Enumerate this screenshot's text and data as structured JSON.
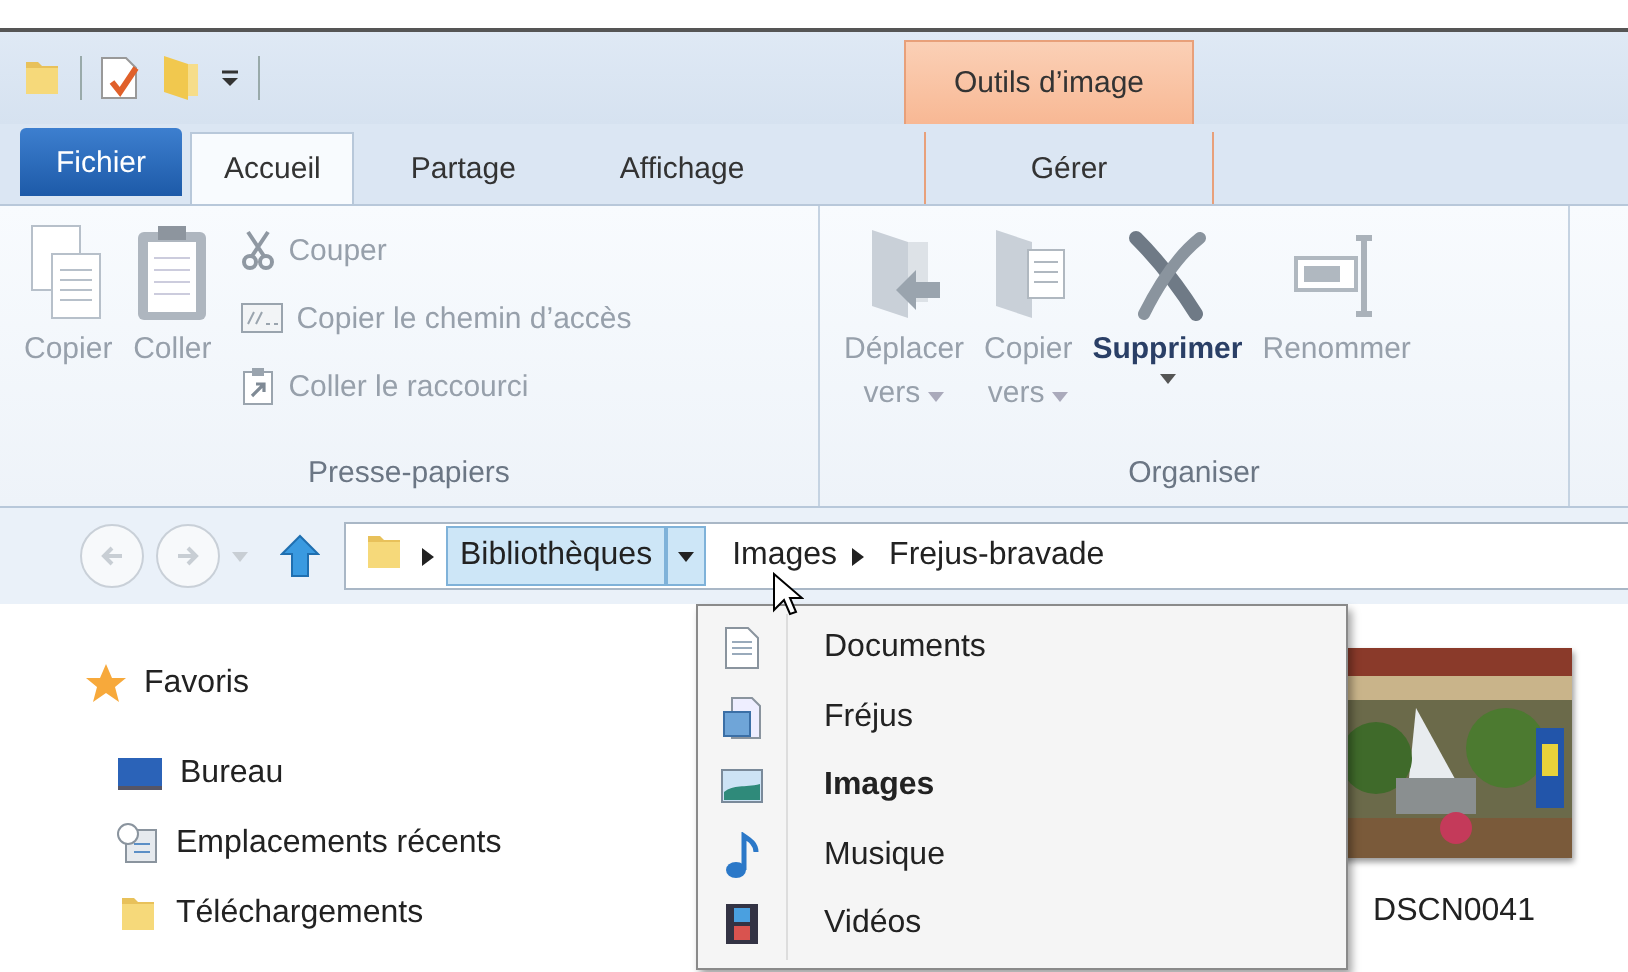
{
  "context_tab": {
    "title": "Outils d’image"
  },
  "tabs": [
    {
      "label": "Fichier",
      "kind": "file",
      "selected": false
    },
    {
      "label": "Accueil",
      "kind": "tab",
      "selected": true
    },
    {
      "label": "Partage",
      "kind": "tab",
      "selected": false
    },
    {
      "label": "Affichage",
      "kind": "tab",
      "selected": false
    },
    {
      "label": "Gérer",
      "kind": "context",
      "selected": false
    }
  ],
  "ribbon": {
    "groups": [
      {
        "label": "Presse-papiers",
        "large": [
          {
            "label": "Copier",
            "kind": "copy",
            "disabled": true
          },
          {
            "label": "Coller",
            "kind": "paste",
            "disabled": true
          }
        ],
        "small": [
          {
            "label": "Couper",
            "kind": "cut",
            "disabled": true
          },
          {
            "label": "Copier le chemin d’accès",
            "kind": "path",
            "disabled": true
          },
          {
            "label": "Coller le raccourci",
            "kind": "shortcut",
            "disabled": true
          }
        ]
      },
      {
        "label": "Organiser",
        "large": [
          {
            "label": "Déplacer",
            "sub": "vers",
            "kind": "move",
            "dropdown": true,
            "disabled": true
          },
          {
            "label": "Copier",
            "sub": "vers",
            "kind": "copyto",
            "dropdown": true,
            "disabled": true
          },
          {
            "label": "Supprimer",
            "kind": "delete",
            "dropdown": true,
            "disabled": false
          },
          {
            "label": "Renommer",
            "kind": "rename",
            "disabled": true
          }
        ]
      }
    ]
  },
  "address_bar": {
    "segments": [
      {
        "label": "Bibliothèques",
        "highlighted": true,
        "menu_open": true,
        "arrow_after": false
      },
      {
        "label": "Images",
        "highlighted": false,
        "menu_open": false,
        "arrow_after": true
      },
      {
        "label": "Frejus-bravade",
        "highlighted": false,
        "menu_open": false,
        "arrow_after": false
      }
    ]
  },
  "sidebar": {
    "items": [
      {
        "label": "Favoris",
        "kind": "star",
        "children": [
          {
            "label": "Bureau",
            "kind": "desktop"
          },
          {
            "label": "Emplacements récents",
            "kind": "recent"
          },
          {
            "label": "Téléchargements",
            "kind": "folder"
          }
        ]
      }
    ]
  },
  "dropdown_menu": {
    "items": [
      {
        "label": "Documents",
        "kind": "documents",
        "selected": false
      },
      {
        "label": "Fréjus",
        "kind": "library",
        "selected": false
      },
      {
        "label": "Images",
        "kind": "images",
        "selected": true
      },
      {
        "label": "Musique",
        "kind": "music",
        "selected": false
      },
      {
        "label": "Vidéos",
        "kind": "videos",
        "selected": false
      }
    ]
  },
  "files": [
    {
      "name": "DSCN0041",
      "kind": "picture"
    }
  ]
}
